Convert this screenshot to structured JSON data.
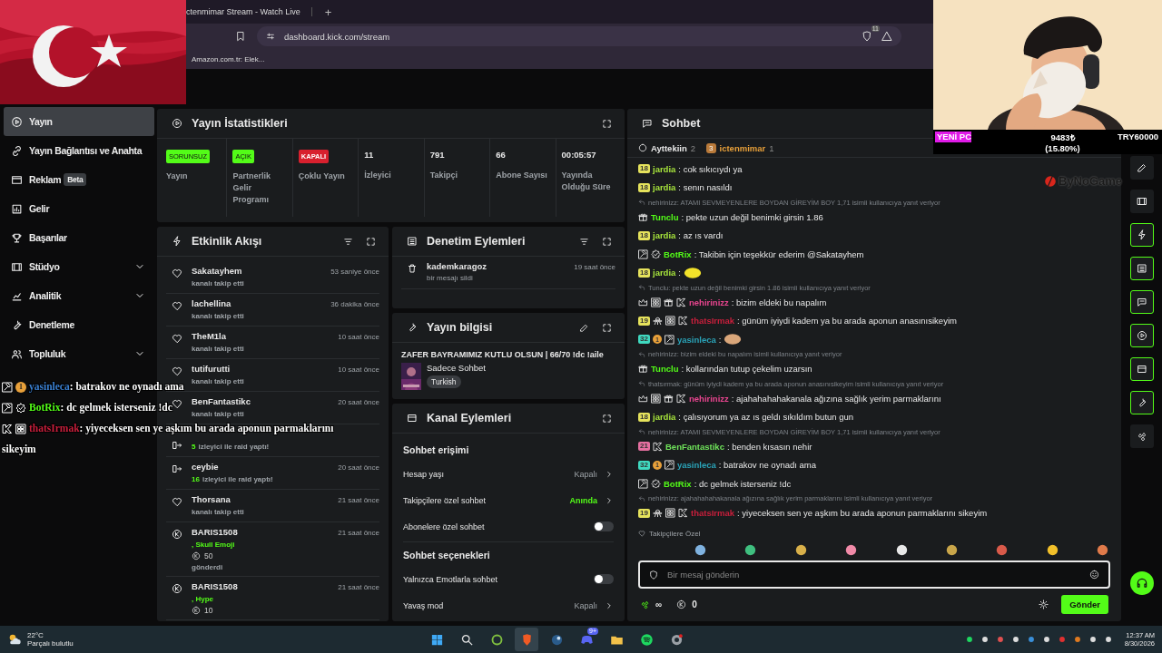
{
  "browser": {
    "tab_title": "ctenmimar Stream - Watch Live",
    "new_tab": "+",
    "url": "dashboard.kick.com/stream",
    "shield_count": "11",
    "bookmark": "Amazon.com.tr: Elek..."
  },
  "sidebar": {
    "items": [
      {
        "label": "Yayın",
        "selected": true,
        "expandable": false
      },
      {
        "label": "Yayın Bağlantısı ve Anahta",
        "selected": false,
        "expandable": false
      },
      {
        "label": "Reklam",
        "selected": false,
        "expandable": false,
        "badge": "Beta"
      },
      {
        "label": "Gelir",
        "selected": false,
        "expandable": false
      },
      {
        "label": "Başarılar",
        "selected": false,
        "expandable": false
      },
      {
        "label": "Stüdyo",
        "selected": false,
        "expandable": true
      },
      {
        "label": "Analitik",
        "selected": false,
        "expandable": true
      },
      {
        "label": "Denetleme",
        "selected": false,
        "expandable": false
      },
      {
        "label": "Topluluk",
        "selected": false,
        "expandable": true
      }
    ]
  },
  "stats": {
    "title": "Yayın İstatistikleri",
    "items": [
      {
        "kind": "status",
        "badge": "SORUNSUZ",
        "on": true,
        "label": "Yayın"
      },
      {
        "kind": "status",
        "badge": "AÇIK",
        "on": true,
        "label": "Partnerlik Gelir Programı"
      },
      {
        "kind": "status",
        "badge": "KAPALI",
        "on": false,
        "label": "Çoklu Yayın"
      },
      {
        "kind": "number",
        "value": "11",
        "label": "İzleyici"
      },
      {
        "kind": "number",
        "value": "791",
        "label": "Takipçi"
      },
      {
        "kind": "number",
        "value": "66",
        "label": "Abone Sayısı"
      },
      {
        "kind": "number",
        "value": "00:05:57",
        "label": "Yayında Olduğu Süre"
      }
    ]
  },
  "events": {
    "title": "Etkinlik Akışı",
    "items": [
      {
        "kind": "follow",
        "name": "Sakatayhem",
        "time": "53 saniye önce",
        "detail": "kanalı takip etti"
      },
      {
        "kind": "follow",
        "name": "lachellina",
        "time": "36 dakika önce",
        "detail": "kanalı takip etti"
      },
      {
        "kind": "follow",
        "name": "TheM1la",
        "time": "10 saat önce",
        "detail": "kanalı takip etti"
      },
      {
        "kind": "follow",
        "name": "tutifurutti",
        "time": "10 saat önce",
        "detail": "kanalı takip etti"
      },
      {
        "kind": "follow",
        "name": "BenFantastikc",
        "time": "20 saat önce",
        "detail": "kanalı takip etti"
      },
      {
        "kind": "raid",
        "count": "5",
        "detail": "izleyici ile raid yaptı!"
      },
      {
        "kind": "raid",
        "name": "ceybie",
        "time": "20 saat önce",
        "count": "16",
        "detail": "izleyici ile raid yaptı!"
      },
      {
        "kind": "follow",
        "name": "Thorsana",
        "time": "21 saat önce",
        "detail": "kanalı takip etti"
      },
      {
        "kind": "gift",
        "name": "BARIS1508",
        "time": "21 saat önce",
        "item": ", Skull Emoji",
        "amount": "50",
        "detail": "gönderdi"
      },
      {
        "kind": "gift",
        "name": "BARIS1508",
        "time": "21 saat önce",
        "item": ", Hype",
        "amount": "10"
      }
    ]
  },
  "moderation": {
    "title": "Denetim Eylemleri",
    "items": [
      {
        "name": "kademkaragoz",
        "detail": "bir mesajı sildi",
        "time": "19 saat önce"
      }
    ]
  },
  "stream_info": {
    "title": "Yayın bilgisi",
    "stream_title": "ZAFER BAYRAMIMIZ KUTLU OLSUN | 66/70 !dc !aile",
    "category": "Sadece Sohbet",
    "tag": "Turkish"
  },
  "channel_actions": {
    "title": "Kanal Eylemleri",
    "sections": [
      {
        "heading": "Sohbet erişimi",
        "rows": [
          {
            "kind": "value",
            "label": "Hesap yaşı",
            "value": "Kapalı",
            "active": false
          },
          {
            "kind": "value",
            "label": "Takipçilere özel sohbet",
            "value": "Anında",
            "active": true
          },
          {
            "kind": "toggle",
            "label": "Abonelere özel sohbet",
            "on": false
          }
        ]
      },
      {
        "heading": "Sohbet seçenekleri",
        "rows": [
          {
            "kind": "toggle",
            "label": "Yalnızca Emotlarla sohbet",
            "on": false
          },
          {
            "kind": "value",
            "label": "Yavaş mod",
            "value": "Kapalı",
            "active": false
          }
        ]
      }
    ]
  },
  "chat": {
    "title": "Sohbet",
    "leaderboard": [
      {
        "name": "Ayttekiin",
        "count": "2"
      },
      {
        "name": "ictenmimar",
        "count": "1",
        "rank": "3"
      }
    ],
    "messages": [
      {
        "badges": [
          {
            "kind": "sub",
            "label": "18",
            "color": "#e6e35c"
          }
        ],
        "user": "jardia",
        "color": "#a8e63c",
        "text": ": cok sıkıcıydı ya"
      },
      {
        "badges": [
          {
            "kind": "sub",
            "label": "18",
            "color": "#e6e35c"
          }
        ],
        "user": "jardia",
        "color": "#a8e63c",
        "text": ": senın nasıldı"
      },
      {
        "reply": "nehirinizz: ATAMI SEVMEYENLERE BOYDAN GİREYİM BOY 1,71 isimli kullanıcıya yanıt veriyor",
        "badges": [
          {
            "kind": "gift"
          }
        ],
        "user": "Tunclu",
        "color": "#53fc18",
        "text": ": pekte uzun değil benimki girsin 1.86"
      },
      {
        "badges": [
          {
            "kind": "sub",
            "label": "18",
            "color": "#e6e35c"
          }
        ],
        "user": "jardia",
        "color": "#a8e63c",
        "text": ": az ıs vardı"
      },
      {
        "badges": [
          {
            "kind": "mod"
          },
          {
            "kind": "verified"
          }
        ],
        "user": "BotRix",
        "color": "#53fc18",
        "text": ": Takibin için teşekkür ederim @Sakatayhem"
      },
      {
        "badges": [
          {
            "kind": "sub",
            "label": "18",
            "color": "#e6e35c"
          }
        ],
        "user": "jardia",
        "color": "#a8e63c",
        "text": ":",
        "emote": {
          "color": "#f2e22a"
        }
      },
      {
        "reply": "Tunclu: pekte uzun değil benimki girsin 1.86 isimli kullanıcıya yanıt veriyor",
        "badges": [
          {
            "kind": "crown"
          },
          {
            "kind": "og"
          },
          {
            "kind": "gift"
          },
          {
            "kind": "kick"
          }
        ],
        "user": "nehirinizz",
        "color": "#e8458f",
        "text": ": bizim eldeki bu napalım"
      },
      {
        "badges": [
          {
            "kind": "sub",
            "label": "19",
            "color": "#e6e35c"
          },
          {
            "kind": "ufo"
          },
          {
            "kind": "og"
          },
          {
            "kind": "kick"
          }
        ],
        "user": "thatsIrmak",
        "color": "#c91f3c",
        "text": ": günüm iyiydi kadem ya bu arada aponun anasınısikeyim"
      },
      {
        "badges": [
          {
            "kind": "sub",
            "label": "32",
            "color": "#3fd9c0"
          },
          {
            "kind": "founder",
            "label": "1"
          },
          {
            "kind": "mod"
          }
        ],
        "user": "yasinleca",
        "color": "#2aa3b8",
        "text": ":",
        "emote": {
          "color": "#d9a67a"
        }
      },
      {
        "reply": "nehirinizz: bizim eldeki bu napalım isimli kullanıcıya yanıt veriyor",
        "badges": [
          {
            "kind": "gift"
          }
        ],
        "user": "Tunclu",
        "color": "#53fc18",
        "text": ": kollarından tutup çekelim uzarsın"
      },
      {
        "reply": "thatsırmak: günüm iyiydi kadem ya bu arada aponun anasınısikeyim isimli kullanıcıya yanıt veriyor",
        "badges": [
          {
            "kind": "crown"
          },
          {
            "kind": "og"
          },
          {
            "kind": "gift"
          },
          {
            "kind": "kick"
          }
        ],
        "user": "nehirinizz",
        "color": "#e8458f",
        "text": ": ajahahahahakanala ağızına sağlık yerim parmaklarını"
      },
      {
        "badges": [
          {
            "kind": "sub",
            "label": "18",
            "color": "#e6e35c"
          }
        ],
        "user": "jardia",
        "color": "#a8e63c",
        "text": ": çalısıyorum ya az ıs geldı sıkıldım butun gun"
      },
      {
        "reply": "nehirinizz: ATAMI SEVMEYENLERE BOYDAN GİREYİM BOY 1,71 isimli kullanıcıya yanıt veriyor",
        "badges": [
          {
            "kind": "sub",
            "label": "21",
            "color": "#e56fa0"
          },
          {
            "kind": "kick"
          }
        ],
        "user": "BenFantastikc",
        "color": "#6fe35a",
        "text": ": benden kısasın nehir"
      },
      {
        "badges": [
          {
            "kind": "sub",
            "label": "32",
            "color": "#3fd9c0"
          },
          {
            "kind": "founder",
            "label": "1"
          },
          {
            "kind": "mod"
          }
        ],
        "user": "yasinleca",
        "color": "#2aa3b8",
        "text": ": batrakov ne oynadı ama"
      },
      {
        "badges": [
          {
            "kind": "mod"
          },
          {
            "kind": "verified"
          }
        ],
        "user": "BotRix",
        "color": "#53fc18",
        "text": ": dc gelmek isterseniz !dc"
      },
      {
        "reply": "nehirinizz: ajahahahahakanala ağızına sağlık yerim parmaklarını isimli kullanıcıya yanıt veriyor",
        "badges": [
          {
            "kind": "sub",
            "label": "19",
            "color": "#e6e35c"
          },
          {
            "kind": "ufo"
          },
          {
            "kind": "og"
          },
          {
            "kind": "kick"
          }
        ],
        "user": "thatsIrmak",
        "color": "#c91f3c",
        "text": ": yiyeceksen sen ye aşkım bu arada aponun parmaklarını sikeyim"
      }
    ],
    "followers_only": "Takipçilere Özel",
    "emotes": [
      {
        "color": "#7fb2e0"
      },
      {
        "color": "#3fbf7f"
      },
      {
        "color": "#d9b04a"
      },
      {
        "color": "#f08aa8"
      },
      {
        "color": "#e8e8e8"
      },
      {
        "color": "#c9a64a"
      },
      {
        "color": "#d95a4a"
      },
      {
        "color": "#f2c02a"
      },
      {
        "color": "#e07a4a"
      }
    ],
    "input": {
      "placeholder": "Bir mesaj gönderin"
    },
    "points": "∞",
    "coins": "0",
    "send": "Gönder"
  },
  "rail": [
    {
      "framed": false
    },
    {
      "framed": false
    },
    {
      "framed": true
    },
    {
      "framed": true
    },
    {
      "framed": true
    },
    {
      "framed": true
    },
    {
      "framed": true
    },
    {
      "framed": true
    },
    {
      "framed": false
    }
  ],
  "goal": {
    "label": "YENİ PC",
    "amount": "9483₺",
    "percent": "(15.80%)",
    "target": "TRY60000",
    "level": 0.158
  },
  "logo": "ByNoGame",
  "overlay_chat": [
    {
      "badges": [
        {
          "kind": "mod"
        },
        {
          "kind": "founder",
          "label": "1"
        }
      ],
      "user": "yasinleca",
      "color": "#3a7fd0",
      "text": ": batrakov ne oynadı ama"
    },
    {
      "badges": [
        {
          "kind": "mod"
        },
        {
          "kind": "verified"
        }
      ],
      "user": "BotRix",
      "color": "#53fc18",
      "text": ": dc gelmek isterseniz !dc"
    },
    {
      "badges": [
        {
          "kind": "kick"
        },
        {
          "kind": "og"
        }
      ],
      "user": "thatsIrmak",
      "color": "#c91f3c",
      "text": ": yiyeceksen sen ye aşkım bu arada aponun parmaklarını",
      "text_line2": "sikeyim"
    }
  ],
  "taskbar": {
    "temp": "22°C",
    "weather": "Parçalı bulutlu",
    "apps": [
      {
        "active": false
      },
      {
        "active": false
      },
      {
        "active": false
      },
      {
        "active": true
      },
      {
        "active": false
      },
      {
        "active": false,
        "badge": "9+"
      },
      {
        "active": false
      },
      {
        "active": false
      },
      {
        "active": false
      }
    ],
    "time": "12:37 AM",
    "date": "8/30/2026"
  }
}
